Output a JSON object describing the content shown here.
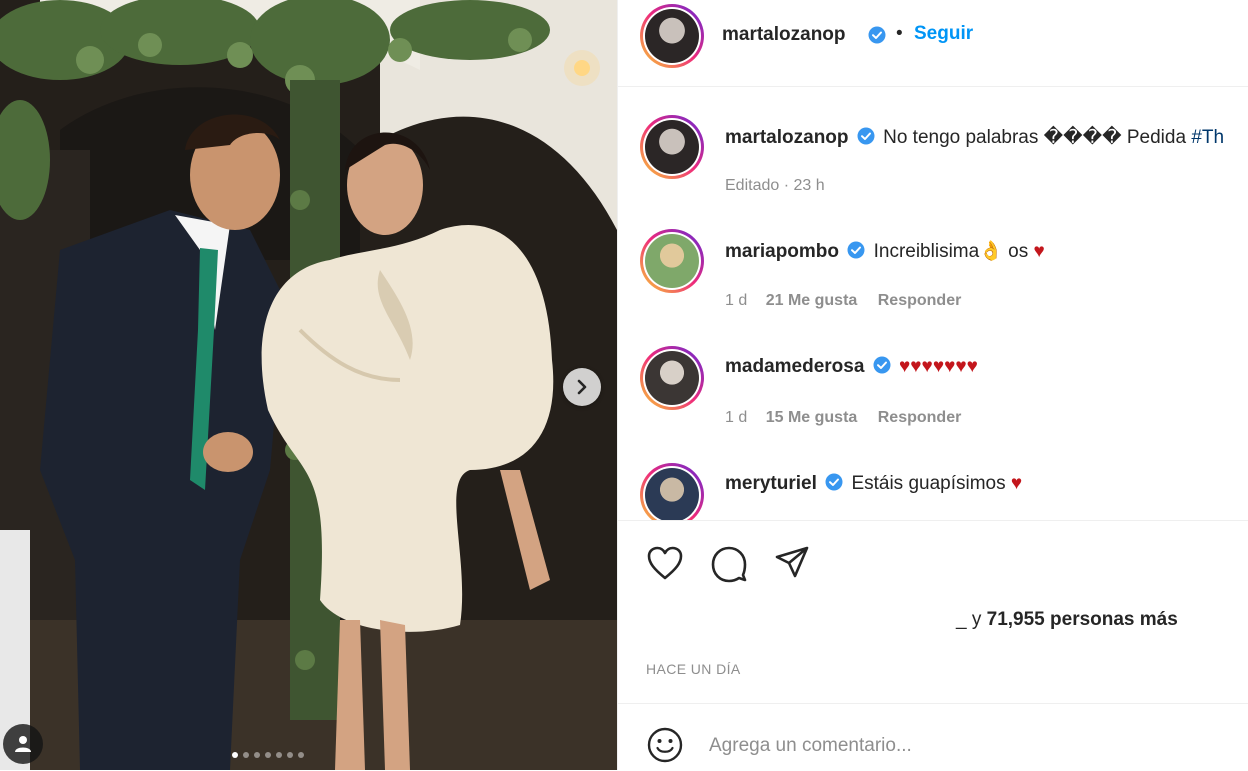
{
  "post": {
    "author": "martalozanop",
    "follow_label": "Seguir",
    "bullet": "•",
    "carousel": {
      "total_slides": 7,
      "active_slide": 1
    }
  },
  "caption": {
    "username": "martalozanop",
    "text": "No tengo palabras ���� Pedida",
    "hashtag": "#Th",
    "meta": "Editado · 23 h"
  },
  "comments": [
    {
      "username": "mariapombo",
      "text": "Increiblisima",
      "emoji_after": "👌",
      "text2": " os ",
      "heart": "♥",
      "time": "1 d",
      "likes": "21 Me gusta",
      "reply": "Responder"
    },
    {
      "username": "madamederosa",
      "text": "",
      "hearts": "♥♥♥♥♥♥♥",
      "time": "1 d",
      "likes": "15 Me gusta",
      "reply": "Responder"
    },
    {
      "username": "meryturiel",
      "text": "Estáis guapísimos",
      "heart": "♥"
    }
  ],
  "likes_summary": {
    "prefix": "_ y ",
    "count": "71,955 personas más"
  },
  "timestamp": "HACE UN DÍA",
  "composer": {
    "placeholder": "Agrega un comentario..."
  },
  "colors": {
    "accent": "#0095f6",
    "verified": "#3897f0",
    "heart": "#c3161c",
    "muted": "#8e8e8e"
  },
  "icons": [
    "heart-icon",
    "comment-icon",
    "share-icon",
    "emoji-icon",
    "chevron-right-icon",
    "user-tag-icon",
    "verified-icon"
  ]
}
